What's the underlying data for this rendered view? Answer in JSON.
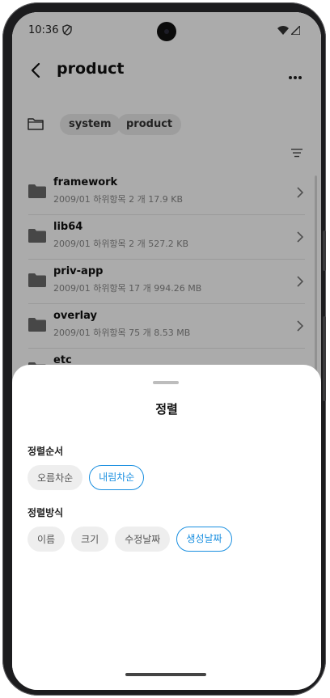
{
  "status_bar": {
    "time": "10:36"
  },
  "header": {
    "title": "product"
  },
  "breadcrumbs": [
    "system",
    "product"
  ],
  "files": [
    {
      "name": "framework",
      "meta": "2009/01 하위항목 2 개 17.9 KB"
    },
    {
      "name": "lib64",
      "meta": "2009/01 하위항목 2 개 527.2 KB"
    },
    {
      "name": "priv-app",
      "meta": "2009/01 하위항목 17 개 994.26 MB"
    },
    {
      "name": "overlay",
      "meta": "2009/01 하위항목 75 개 8.53 MB"
    },
    {
      "name": "etc",
      "meta": ""
    }
  ],
  "sort_sheet": {
    "title": "정렬",
    "order_label": "정렬순서",
    "order_options": [
      {
        "label": "오름차순",
        "selected": false
      },
      {
        "label": "내림차순",
        "selected": true
      }
    ],
    "method_label": "정렬방식",
    "method_options": [
      {
        "label": "이름",
        "selected": false
      },
      {
        "label": "크기",
        "selected": false
      },
      {
        "label": "수정날짜",
        "selected": false
      },
      {
        "label": "생성날짜",
        "selected": true
      }
    ]
  },
  "colors": {
    "accent": "#1a8fe0",
    "chip_bg": "#eeeeee",
    "folder": "#6b6b6b"
  },
  "icons": [
    "back-arrow-icon",
    "more-icon",
    "folder-outline-icon",
    "sort-icon",
    "folder-icon",
    "chevron-right-icon",
    "shield-icon",
    "wifi-icon",
    "signal-icon"
  ]
}
